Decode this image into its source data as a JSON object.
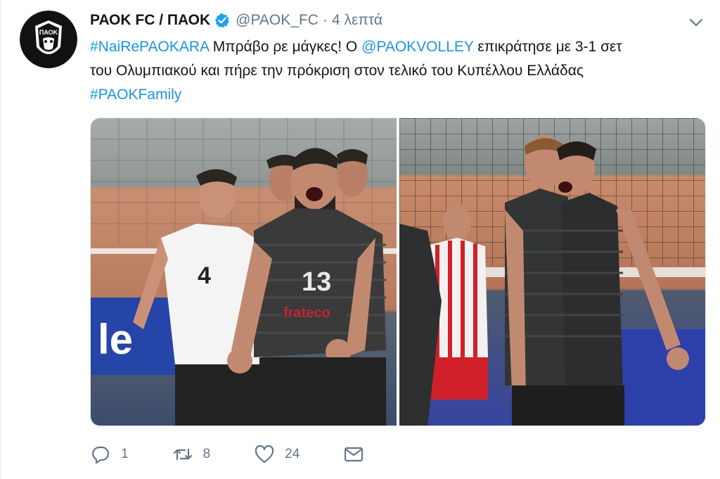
{
  "tweet": {
    "account_name": "ΡΑΟΚ FC / ΠΑΟΚ",
    "handle": "@PAOK_FC",
    "separator": "·",
    "time": "4 λεπτά",
    "text_line1_hashtag": "#NaiRePAOKARA",
    "text_line1_a": " Μπράβο ρε μάγκες! Ο ",
    "text_line1_mention": "@PAOKVOLLEY",
    "text_line1_b": " επικράτησε με 3-1 σετ",
    "text_line2": "του Ολυμπιακού και πήρε την πρόκριση στον τελικό του Κυπέλλου Ελλάδας",
    "text_line3_hashtag": "#PAOKFamily",
    "avatar_text": "ΠΑΟΚ"
  },
  "photo1": {
    "player_number_left": "4",
    "player_number_center": "13",
    "sponsor": "frateco"
  },
  "actions": {
    "reply_count": "1",
    "retweet_count": "8",
    "like_count": "24"
  },
  "icons": {
    "verified": "verified-badge-icon",
    "chevron": "chevron-down-icon",
    "reply": "reply-icon",
    "retweet": "retweet-icon",
    "like": "heart-icon",
    "message": "direct-message-icon"
  },
  "colors": {
    "link": "#1b95e0",
    "muted": "#657786",
    "verified": "#1da1f2"
  }
}
